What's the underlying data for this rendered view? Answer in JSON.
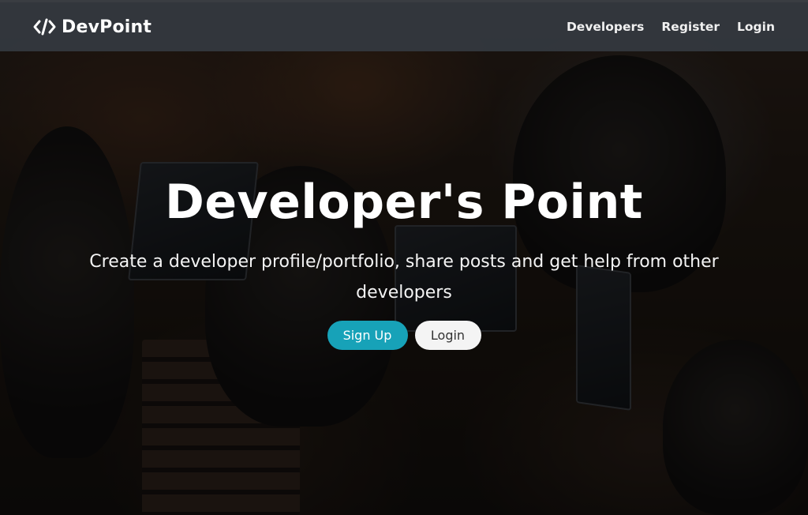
{
  "navbar": {
    "brand_icon": "code-icon",
    "brand_name": "DevPoint",
    "links": [
      "Developers",
      "Register",
      "Login"
    ]
  },
  "hero": {
    "title": "Developer's Point",
    "lead": "Create a developer profile/portfolio, share posts and get help from other developers",
    "signup_label": "Sign Up",
    "login_label": "Login"
  },
  "colors": {
    "navbar_bg": "#343a40",
    "primary": "#17a2b8",
    "light": "#f4f4f4"
  }
}
